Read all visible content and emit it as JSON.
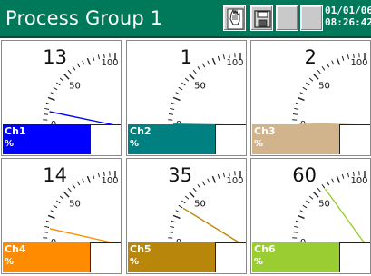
{
  "header": {
    "title": "Process Group 1",
    "date": "01/01/06",
    "time": "08:26:42"
  },
  "colors": {
    "titlebar": "#00795b"
  },
  "scale": {
    "min": "0",
    "mid": "50",
    "max": "100"
  },
  "channels": [
    {
      "name": "Ch1",
      "unit": "%",
      "value": "13",
      "color": "#0000ff"
    },
    {
      "name": "Ch2",
      "unit": "%",
      "value": "1",
      "color": "#008080"
    },
    {
      "name": "Ch3",
      "unit": "%",
      "value": "2",
      "color": "#d2b48c"
    },
    {
      "name": "Ch4",
      "unit": "%",
      "value": "14",
      "color": "#ff8c00"
    },
    {
      "name": "Ch5",
      "unit": "%",
      "value": "35",
      "color": "#b8860b"
    },
    {
      "name": "Ch6",
      "unit": "%",
      "value": "60",
      "color": "#9acd32"
    }
  ],
  "toolbar": {
    "icons": [
      "hand-pointer-icon",
      "save-icon",
      "blank-icon",
      "blank-icon"
    ]
  }
}
